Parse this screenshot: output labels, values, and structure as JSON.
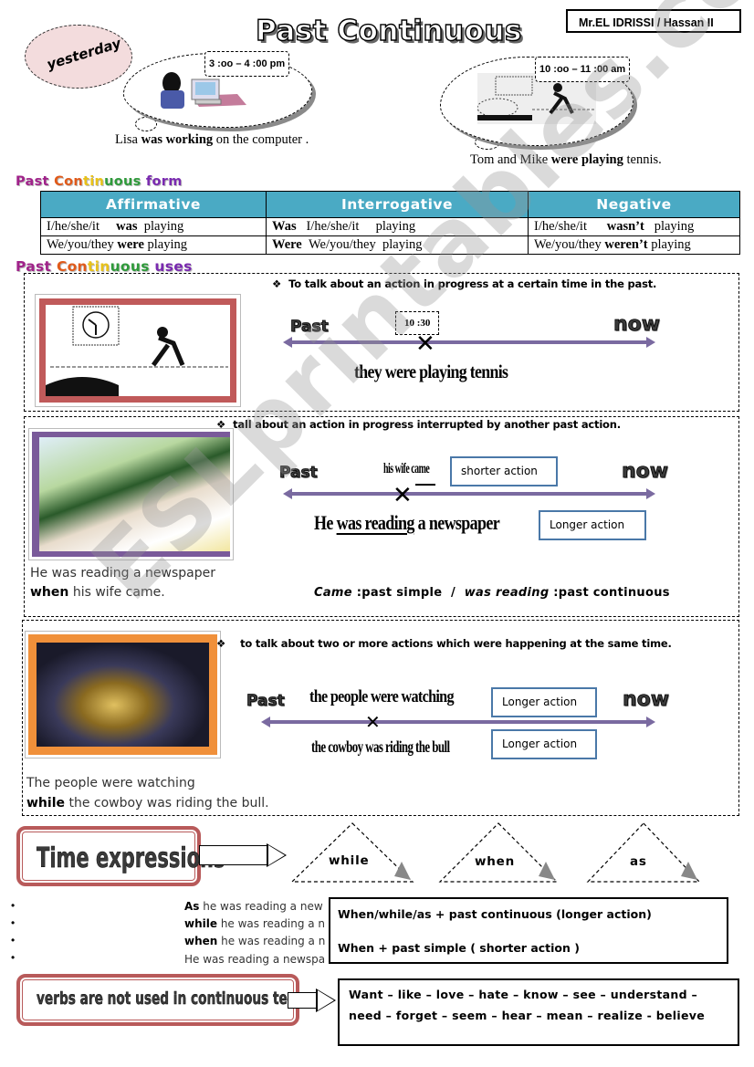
{
  "header": {
    "title": "Past Continuous",
    "author": "Mr.EL IDRISSI / Hassan II",
    "yesterday_label": "yesterday"
  },
  "intro": {
    "left": {
      "time": "3 :oo – 4 :00 pm",
      "image_icon": "woman-at-computer-image",
      "caption_pre": "Lisa ",
      "caption_bold": "was working",
      "caption_post": " on the computer ."
    },
    "right": {
      "time": "10 :oo – 11 :00 am",
      "image_icon": "tennis-players-image",
      "caption_pre": "Tom and Mike ",
      "caption_bold": "were playing",
      "caption_post": " tennis."
    }
  },
  "form": {
    "heading": [
      "Past ",
      "Con",
      "tin",
      "uous",
      " form"
    ],
    "columns": [
      "Affirmative",
      "Interrogative",
      "Negative"
    ],
    "rows": [
      [
        {
          "pre": "I/he/she/it     ",
          "bold": "was",
          "post": "  playing"
        },
        {
          "pre": "",
          "bold": "Was",
          "post": "   I/he/she/it     playing"
        },
        {
          "pre": "I/he/she/it      ",
          "bold": "wasn’t",
          "post": "   playing"
        }
      ],
      [
        {
          "pre": "We/you/they ",
          "bold": "were",
          "post": " playing"
        },
        {
          "pre": "",
          "bold": "Were",
          "post": "  We/you/they  playing"
        },
        {
          "pre": "We/you/they ",
          "bold": "weren’t",
          "post": " playing"
        }
      ]
    ]
  },
  "uses": {
    "heading": [
      "Past ",
      "Con",
      "tin",
      "uous",
      " uses"
    ],
    "past_label": "Past",
    "now_label": "now",
    "use1": {
      "bullet": "To talk about an action in progress at a certain time in the past.",
      "image_icon": "tennis-clock-image",
      "time_marker": "10 :30",
      "sentence": "they were playing tennis"
    },
    "use2": {
      "bullet": "tall about an action in progress interrupted by another past action.",
      "image_icon": "elderly-couple-newspaper-image",
      "short_event": "his wife came",
      "short_label": "shorter action",
      "long_sentence_pre": "He ",
      "long_sentence_underlined": "was reading",
      "long_sentence_post": " a newspaper",
      "long_label": "Longer action",
      "caption_line1": "He was reading a newspaper",
      "caption_bold": "when",
      "caption_line2_post": " his wife came.",
      "note_italic1": "Came",
      "note_text1": " :past simple  /  ",
      "note_italic2": "was reading",
      "note_text2": " :past continuous"
    },
    "use3": {
      "bullet": "to talk about two or more actions which were happening at the same time.",
      "image_icon": "rodeo-bull-riding-image",
      "top_sentence": "the people were watching",
      "top_label": "Longer action",
      "bottom_sentence": "the cowboy was riding the bull",
      "bottom_label": "Longer action",
      "caption_line1": "The people were watching",
      "caption_bold": "while",
      "caption_line2_post": " the cowboy was riding the bull."
    }
  },
  "time_expressions": {
    "title": "Time expressions",
    "words": [
      "while",
      "when",
      "as"
    ],
    "examples": [
      {
        "bold": "As",
        "text": " he was reading a new"
      },
      {
        "bold": "while",
        "text": " he was reading a n"
      },
      {
        "bold": "when",
        "text": " he was reading a n"
      },
      {
        "bold": "",
        "text": "He was reading a newspa"
      }
    ],
    "rules": [
      "When/while/as + past continuous (longer action)",
      "When + past simple ( shorter action )"
    ]
  },
  "stative": {
    "title": "verbs are not used in continuous tenses",
    "line1": "Want – like – love – hate – know – see – understand –",
    "line2": "need – forget – seem – hear – mean – realize - believe"
  },
  "watermark": "ESLprintables.com",
  "colors": {
    "table_header": "#4aaac4",
    "timeline": "#7a6aa0",
    "action_box_border": "#4a78a8",
    "frame_red": "#c05a5a",
    "frame_purple": "#7a5a9a",
    "frame_orange": "#f0903a",
    "yesterday_fill": "#f3dcdd"
  }
}
